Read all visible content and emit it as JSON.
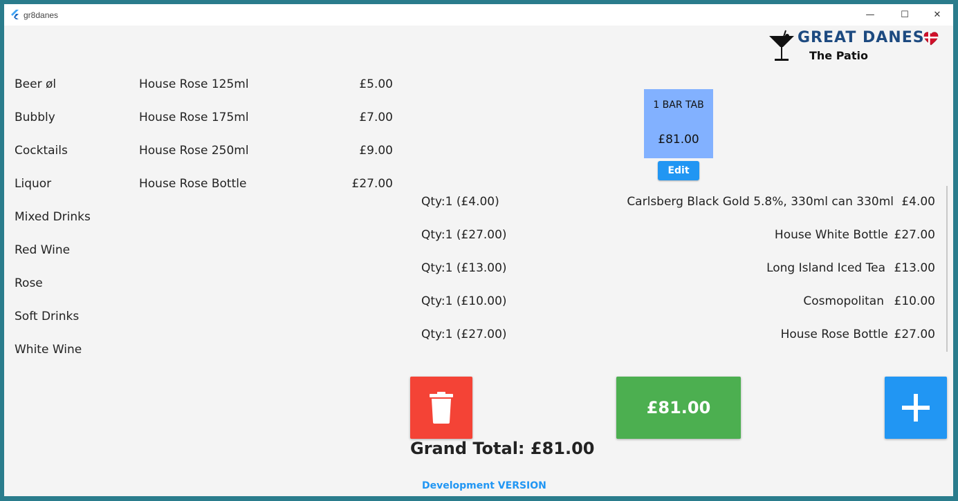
{
  "window": {
    "title": "gr8danes",
    "controls": {
      "minimize": "—",
      "maximize": "☐",
      "close": "✕"
    }
  },
  "logo": {
    "title": "GREAT DANES",
    "subtitle": "The Patio",
    "glass_icon": "cocktail-glass-icon",
    "flag_icon": "danish-flag-heart-icon"
  },
  "categories": [
    "Beer øl",
    "Bubbly",
    "Cocktails",
    "Liquor",
    "Mixed Drinks",
    "Red Wine",
    "Rose",
    "Soft Drinks",
    "White Wine"
  ],
  "products": [
    {
      "name": "House Rose 125ml",
      "price": "£5.00"
    },
    {
      "name": "House Rose 175ml",
      "price": "£7.00"
    },
    {
      "name": "House Rose 250ml",
      "price": "£9.00"
    },
    {
      "name": "House Rose Bottle",
      "price": "£27.00"
    }
  ],
  "tab": {
    "name": "1 BAR TAB",
    "total": "£81.00",
    "edit_label": "Edit"
  },
  "order_items": [
    {
      "qty": "Qty:1 (£4.00)",
      "description": "Carlsberg Black Gold 5.8%, 330ml can 330ml",
      "price": "£4.00"
    },
    {
      "qty": "Qty:1 (£27.00)",
      "description": "House White Bottle",
      "price": "£27.00"
    },
    {
      "qty": "Qty:1 (£13.00)",
      "description": "Long Island Iced Tea",
      "price": "£13.00"
    },
    {
      "qty": "Qty:1 (£10.00)",
      "description": "Cosmopolitan",
      "price": "£10.00"
    },
    {
      "qty": "Qty:1 (£27.00)",
      "description": "House Rose Bottle",
      "price": "£27.00"
    }
  ],
  "actions": {
    "delete_icon": "trash-icon",
    "pay_label": "£81.00",
    "add_icon": "plus-icon"
  },
  "grand_total": "Grand Total: £81.00",
  "dev_label": "Development VERSION",
  "colors": {
    "tab_card": "#82b1ff",
    "edit": "#2196f3",
    "delete": "#f44336",
    "pay": "#4caf50",
    "add": "#2196f3",
    "logo_title": "#1d4a80"
  }
}
